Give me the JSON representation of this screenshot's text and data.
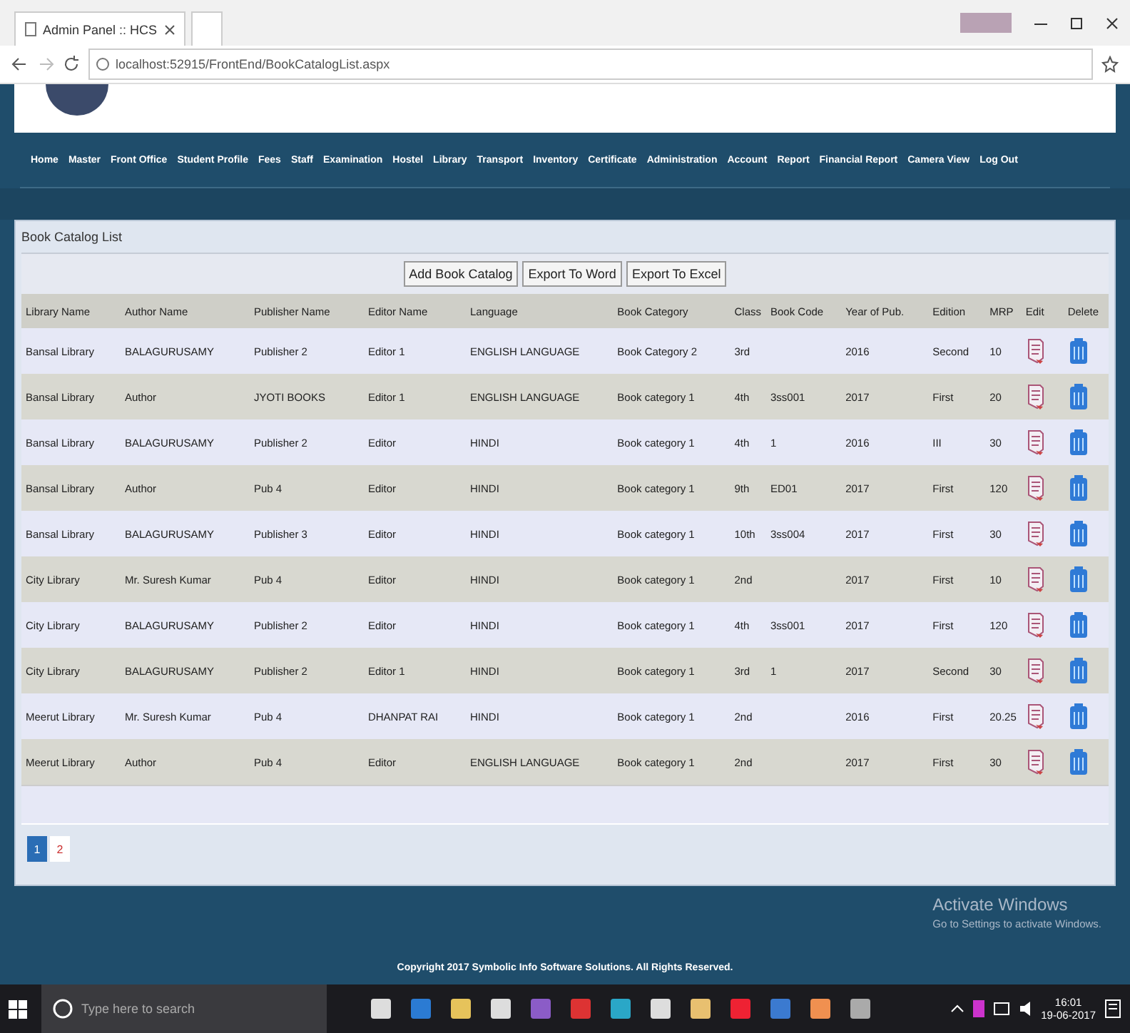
{
  "browser": {
    "tab_title": "Admin Panel :: HCS",
    "url": "localhost:52915/FrontEnd/BookCatalogList.aspx"
  },
  "nav": [
    "Home",
    "Master",
    "Front Office",
    "Student Profile",
    "Fees",
    "Staff",
    "Examination",
    "Hostel",
    "Library",
    "Transport",
    "Inventory",
    "Certificate",
    "Administration",
    "Account",
    "Report",
    "Financial Report",
    "Camera View",
    "Log Out"
  ],
  "panel": {
    "title": "Book Catalog List",
    "buttons": [
      "Add Book Catalog",
      "Export To Word",
      "Export To Excel"
    ],
    "table": {
      "columns": [
        "Library Name",
        "Author Name",
        "Publisher Name",
        "Editor Name",
        "Language",
        "Book Category",
        "Class",
        "Book Code",
        "Year of Pub.",
        "Edition",
        "MRP",
        "Edit",
        "Delete"
      ],
      "rows": [
        {
          "library": "Bansal Library",
          "author": "BALAGURUSAMY",
          "publisher": "Publisher 2",
          "editor": "Editor 1",
          "language": "ENGLISH LANGUAGE",
          "category": "Book Category 2",
          "class": "3rd",
          "year": "2016",
          "edition": "Second",
          "mrp": "10"
        },
        {
          "library": "Bansal Library",
          "author": "Author",
          "publisher": "JYOTI BOOKS",
          "editor": "Editor 1",
          "language": "ENGLISH LANGUAGE",
          "category": "Book category 1",
          "class": "4th",
          "book_code": "3ss001",
          "year": "2017",
          "edition": "First",
          "mrp": "20"
        },
        {
          "library": "Bansal Library",
          "author": "BALAGURUSAMY",
          "publisher": "Publisher 2",
          "editor": "Editor",
          "language": "HINDI",
          "category": "Book category 1",
          "class": "4th",
          "book_code": "1",
          "year": "2016",
          "edition": "III",
          "mrp": "30"
        },
        {
          "library": "Bansal Library",
          "author": "Author",
          "publisher": "Pub 4",
          "editor": "Editor",
          "language": "HINDI",
          "category": "Book category 1",
          "class": "9th",
          "book_code": "ED01",
          "year": "2017",
          "edition": "First",
          "mrp": "120"
        },
        {
          "library": "Bansal Library",
          "author": "BALAGURUSAMY",
          "publisher": "Publisher 3",
          "editor": "Editor",
          "language": "HINDI",
          "category": "Book category 1",
          "class": "10th",
          "book_code": "3ss004",
          "year": "2017",
          "edition": "First",
          "mrp": "30"
        },
        {
          "library": "City Library",
          "author": "Mr. Suresh Kumar",
          "publisher": "Pub 4",
          "editor": "Editor",
          "language": "HINDI",
          "category": "Book category 1",
          "class": "2nd",
          "year": "2017",
          "edition": "First",
          "mrp": "10"
        },
        {
          "library": "City Library",
          "author": "BALAGURUSAMY",
          "publisher": "Publisher 2",
          "editor": "Editor",
          "language": "HINDI",
          "category": "Book category 1",
          "class": "4th",
          "book_code": "3ss001",
          "year": "2017",
          "edition": "First",
          "mrp": "120"
        },
        {
          "library": "City Library",
          "author": "BALAGURUSAMY",
          "publisher": "Publisher 2",
          "editor": "Editor 1",
          "language": "HINDI",
          "category": "Book category 1",
          "class": "3rd",
          "book_code": "1",
          "year": "2017",
          "edition": "Second",
          "mrp": "30"
        },
        {
          "library": "Meerut Library",
          "author": "Mr. Suresh Kumar",
          "publisher": "Pub 4",
          "editor": "DHANPAT RAI",
          "language": "HINDI",
          "category": "Book category 1",
          "class": "2nd",
          "year": "2016",
          "edition": "First",
          "mrp": "20.25"
        },
        {
          "library": "Meerut Library",
          "author": "Author",
          "publisher": "Pub 4",
          "editor": "Editor",
          "language": "ENGLISH LANGUAGE",
          "category": "Book category 1",
          "class": "2nd",
          "year": "2017",
          "edition": "First",
          "mrp": "30"
        }
      ]
    },
    "pagination": [
      {
        "label": "1",
        "selected": true
      },
      {
        "label": "2",
        "selected": false
      }
    ]
  },
  "footer": {
    "copyright": "Copyright 2017 Symbolic Info Software Solutions. All Rights Reserved."
  },
  "activation": {
    "title": "Activate Windows",
    "subtitle": "Go to Settings to activate Windows."
  },
  "taskbar": {
    "search_placeholder": "Type here to search",
    "time": "16:01",
    "date": "19-06-2017"
  }
}
